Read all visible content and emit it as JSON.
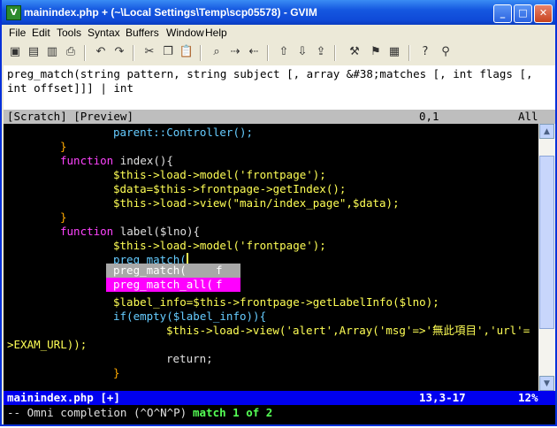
{
  "window": {
    "title": "mainindex.php + (~\\Local Settings\\Temp\\scp05578) - GVIM",
    "icon": "vim-icon",
    "buttons": {
      "minimize": "_",
      "maximize": "□",
      "close": "✕"
    }
  },
  "menu": [
    "File",
    "Edit",
    "Tools",
    "Syntax",
    "Buffers",
    "Window",
    "Help"
  ],
  "toolbar": [
    "open-icon",
    "save-icon",
    "save-all-icon",
    "print-icon",
    "undo-icon",
    "redo-icon",
    "cut-icon",
    "copy-icon",
    "paste-icon",
    "find-icon",
    "find-next-icon",
    "find-prev-icon",
    "load-session-icon",
    "save-session-icon",
    "run-script-icon",
    "make-icon",
    "tag-icon",
    "help-icon",
    "find-help-icon"
  ],
  "preview": {
    "line1": "preg_match(string pattern, string subject [, array &#38;matches [, int flags [,",
    "line2": "int offset]]] | int"
  },
  "preview_status": {
    "left": "[Scratch] [Preview]",
    "pos": "0,1",
    "pct": "All"
  },
  "code": {
    "l1": "parent::Controller();",
    "l2": "}",
    "l3_kw": "function",
    "l3_rest": " index(){",
    "l4": "$this->load->model('frontpage');",
    "l5": "$data=$this->frontpage->getIndex();",
    "l6": "$this->load->view(\"main/index_page\",$data);",
    "l7": "}",
    "l8_kw": "function",
    "l8_rest": " label($lno){",
    "l9": "$this->load->model('frontpage');",
    "l10": "preg_match(",
    "l11": "$label_info=$this->frontpage->getLabelInfo($lno);",
    "l12": "if(empty($label_info)){",
    "l13": "$this->load->view('alert',Array('msg'=>'無此項目','url'=",
    "l14": ">EXAM_URL));",
    "l15": "return;",
    "l16": "}"
  },
  "popup": [
    {
      "word": "preg_match(",
      "kind": "f"
    },
    {
      "word": "preg_match_all(",
      "kind": "f"
    }
  ],
  "status": {
    "file": "mainindex.php [+]",
    "pos": "13,3-17",
    "pct": "12%"
  },
  "cmdline": {
    "mode": "-- Omni completion (^O^N^P)",
    "match": "match 1 of 2"
  }
}
